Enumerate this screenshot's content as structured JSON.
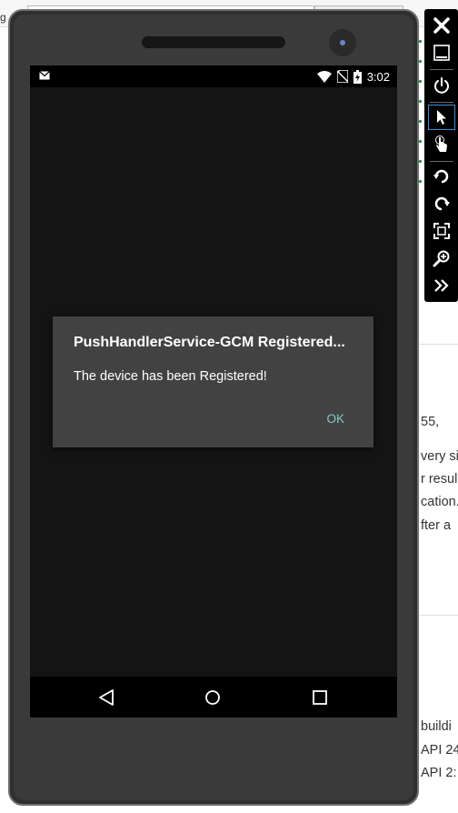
{
  "background": {
    "left_fragment": "g",
    "right_lines": [
      {
        "text": "55,"
      },
      {
        "text": "very sir"
      },
      {
        "text": "r resul"
      },
      {
        "text": "cation."
      },
      {
        "text": "fter a"
      },
      {
        "text": "buildi"
      },
      {
        "text": "API 24"
      },
      {
        "text": "API 2:"
      }
    ]
  },
  "status_bar": {
    "time": "3:02",
    "icons": [
      "mail-icon",
      "wifi-icon",
      "no-sim-icon",
      "battery-charging-icon"
    ]
  },
  "dialog": {
    "title": "PushHandlerService-GCM Registered...",
    "message": "The device has been Registered!",
    "ok_label": "OK"
  },
  "nav_bar": {
    "buttons": [
      "back",
      "home",
      "recents"
    ]
  },
  "toolbar": {
    "tools": [
      "close",
      "minimize",
      "power",
      "select",
      "touch",
      "rotate-left",
      "rotate-right",
      "fit-screen",
      "zoom",
      "more"
    ],
    "selected": "select",
    "colors": {
      "background": "#000000",
      "icon": "#ffffff",
      "selected_border": "#3c8fd6"
    }
  },
  "colors": {
    "dialog_bg": "#424242",
    "dialog_button": "#80cbc4",
    "screen_bg": "#141414"
  }
}
